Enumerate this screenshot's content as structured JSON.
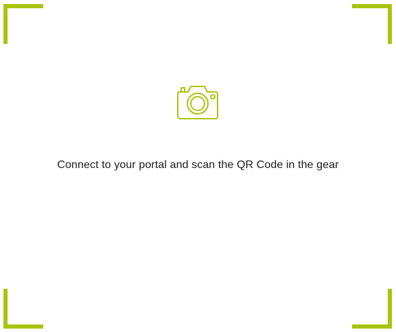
{
  "scanner": {
    "accent_color": "#a6c60f",
    "icon": "camera-icon",
    "instruction": "Connect to your portal and scan the QR Code in the gear"
  }
}
